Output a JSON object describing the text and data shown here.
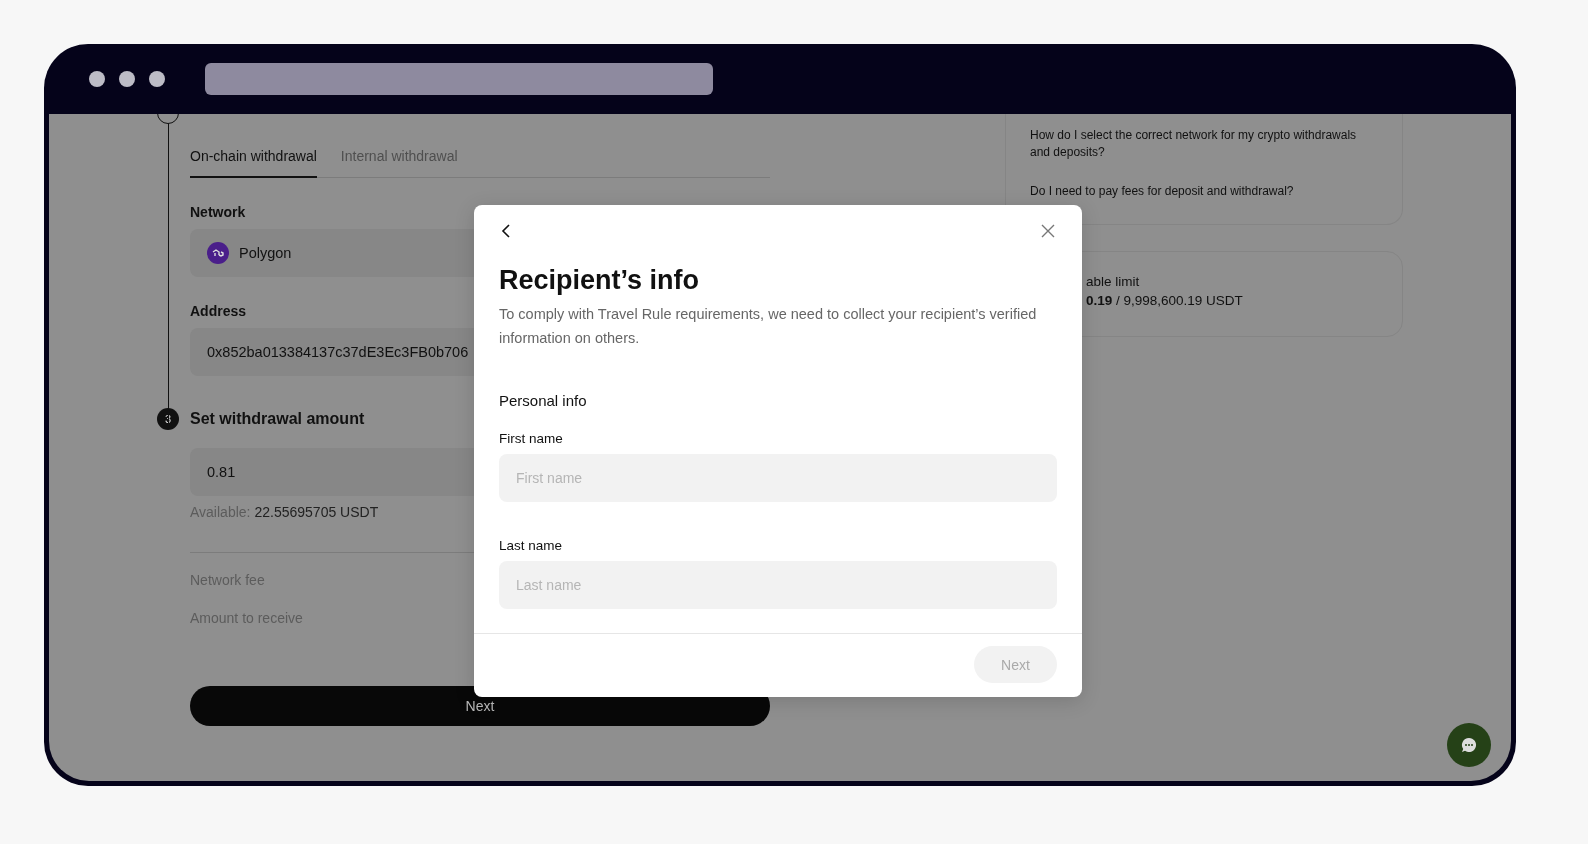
{
  "withdraw": {
    "tabs": [
      {
        "label": "On-chain withdrawal",
        "selected": true
      },
      {
        "label": "Internal withdrawal",
        "selected": false
      }
    ],
    "network": {
      "label": "Network",
      "value": "Polygon"
    },
    "address": {
      "label": "Address",
      "value": "0x852ba013384137c37dE3Ec3FB0b706"
    },
    "step": {
      "number": "3",
      "title": "Set withdrawal amount"
    },
    "amount": {
      "value": "0.81"
    },
    "available": {
      "label": "Available:",
      "value": "22.55695705 USDT"
    },
    "fees": [
      "Network fee",
      "Amount to receive"
    ],
    "next_button": "Next"
  },
  "faq": {
    "questions": [
      "How do I select the correct network for my crypto withdrawals and deposits?",
      "Do I need to pay fees for deposit and withdrawal?"
    ]
  },
  "limit": {
    "label": "able limit",
    "value": "**0.19** / 9,998,600.19 USDT"
  },
  "modal": {
    "title": "Recipient’s info",
    "description": "To comply with Travel Rule requirements, we need to collect your recipient’s verified information on others.",
    "section": "Personal info",
    "fields": [
      {
        "label": "First name",
        "placeholder": "First name"
      },
      {
        "label": "Last name",
        "placeholder": "Last name"
      }
    ],
    "next_button": {
      "label": "Next",
      "disabled": true
    }
  }
}
